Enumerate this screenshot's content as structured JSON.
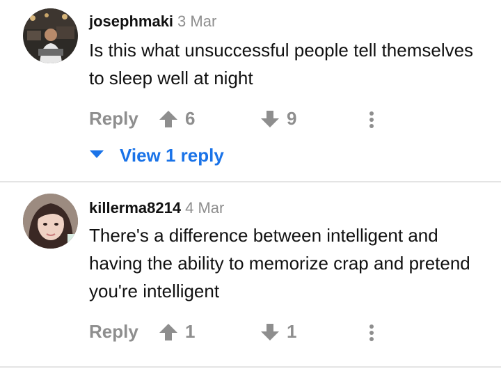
{
  "comments": [
    {
      "username": "josephmaki",
      "date": "3 Mar",
      "text": "Is this what unsuccessful people tell themselves to sleep well at night",
      "reply_label": "Reply",
      "upvotes": "6",
      "downvotes": "9",
      "view_replies_label": "View 1 reply"
    },
    {
      "username": "killerma8214",
      "date": "4 Mar",
      "text": "There's a difference between intelligent and having the ability to memorize crap and pretend you're intelligent",
      "reply_label": "Reply",
      "upvotes": "1",
      "downvotes": "1"
    }
  ],
  "colors": {
    "text": "#111111",
    "muted": "#8e8e8e",
    "link": "#1a73e8",
    "divider": "#e4e4e4"
  },
  "icons": {
    "upvote": "arrow-up-icon",
    "downvote": "arrow-down-icon",
    "more": "more-vertical-icon",
    "expand": "caret-down-icon"
  }
}
